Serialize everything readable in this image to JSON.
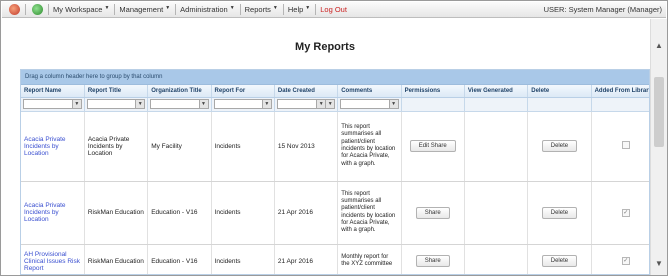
{
  "navbar": {
    "menus": [
      "My Workspace",
      "Management",
      "Administration",
      "Reports",
      "Help"
    ],
    "logout": "Log Out",
    "user": "USER: System Manager (Manager)"
  },
  "page": {
    "title": "My Reports"
  },
  "grid": {
    "group_hint": "Drag a column header here to group by that column",
    "columns": [
      "Report Name",
      "Report Title",
      "Organization Title",
      "Report For",
      "Date Created",
      "Comments",
      "Permissions",
      "View Generated",
      "Delete",
      "Added From Library"
    ],
    "rows": [
      {
        "name": "Acacia Private Incidents by Location",
        "title": "Acacia Private Incidents by Location",
        "org": "My Facility",
        "report_for": "Incidents",
        "date": "15 Nov 2013",
        "comments": "This report summarises all patient/client incidents by location for Acacia Private, with a graph.",
        "permission_label": "Edit Share",
        "delete_label": "Delete",
        "from_library": false
      },
      {
        "name": "Acacia Private Incidents by Location",
        "title": "RiskMan Education",
        "org": "Education - V16",
        "report_for": "Incidents",
        "date": "21 Apr 2016",
        "comments": "This report summarises all patient/client incidents by location for Acacia Private, with a graph.",
        "permission_label": "Share",
        "delete_label": "Delete",
        "from_library": true
      },
      {
        "name": "AH Provisional Clinical Issues Risk Report",
        "title": "RiskMan Education",
        "org": "Education - V16",
        "report_for": "Incidents",
        "date": "21 Apr 2016",
        "comments": "Monthly report for the XYZ committee",
        "permission_label": "Share",
        "delete_label": "Delete",
        "from_library": true
      }
    ]
  }
}
